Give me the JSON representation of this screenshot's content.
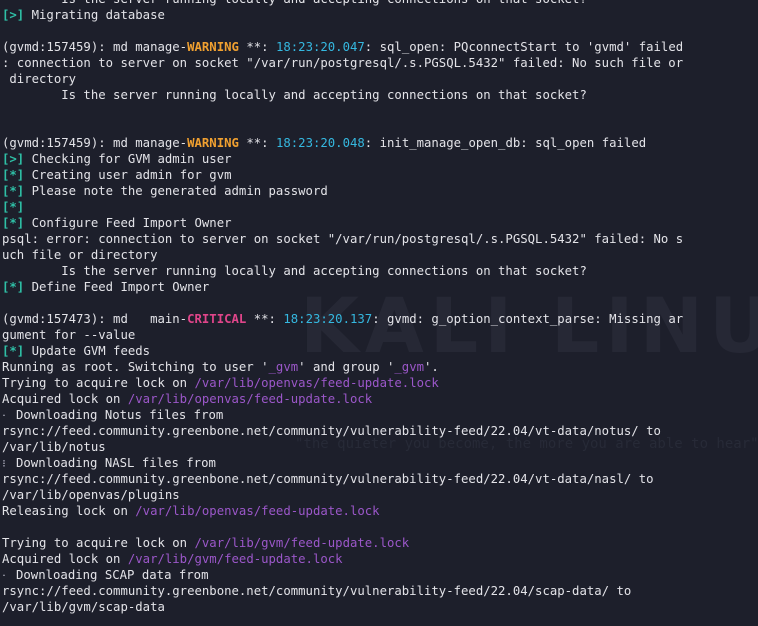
{
  "watermark": {
    "big": "KALI LINUX",
    "small": "\"the quieter you become, the more you are able to hear\""
  },
  "lines": [
    [
      {
        "t": "        Is the server running locally and accepting connections on that socket?"
      }
    ],
    [
      {
        "t": "[>]",
        "c": "tag"
      },
      {
        "t": " Migrating database"
      }
    ],
    [
      {
        "t": ""
      }
    ],
    [
      {
        "t": "(gvmd:157459): md manage-"
      },
      {
        "t": "WARNING",
        "c": "warn"
      },
      {
        "t": " **: "
      },
      {
        "t": "18:23:20.047",
        "c": "ts"
      },
      {
        "t": ": sql_open: PQconnectStart to 'gvmd' failed"
      }
    ],
    [
      {
        "t": ": connection to server on socket \"/var/run/postgresql/.s.PGSQL.5432\" failed: No such file or"
      }
    ],
    [
      {
        "t": " directory"
      }
    ],
    [
      {
        "t": "        Is the server running locally and accepting connections on that socket?"
      }
    ],
    [
      {
        "t": ""
      }
    ],
    [
      {
        "t": ""
      }
    ],
    [
      {
        "t": "(gvmd:157459): md manage-"
      },
      {
        "t": "WARNING",
        "c": "warn"
      },
      {
        "t": " **: "
      },
      {
        "t": "18:23:20.048",
        "c": "ts"
      },
      {
        "t": ": init_manage_open_db: sql_open failed"
      }
    ],
    [
      {
        "t": "[>]",
        "c": "tag"
      },
      {
        "t": " Checking for GVM admin user"
      }
    ],
    [
      {
        "t": "[*]",
        "c": "tag"
      },
      {
        "t": " Creating user admin for gvm"
      }
    ],
    [
      {
        "t": "[*]",
        "c": "tag"
      },
      {
        "t": " Please note the generated admin password"
      }
    ],
    [
      {
        "t": "[*]",
        "c": "tag"
      }
    ],
    [
      {
        "t": "[*]",
        "c": "tag"
      },
      {
        "t": " Configure Feed Import Owner"
      }
    ],
    [
      {
        "t": "psql: error: connection to server on socket \"/var/run/postgresql/.s.PGSQL.5432\" failed: No s"
      }
    ],
    [
      {
        "t": "uch file or directory"
      }
    ],
    [
      {
        "t": "        Is the server running locally and accepting connections on that socket?"
      }
    ],
    [
      {
        "t": "[*]",
        "c": "tag"
      },
      {
        "t": " Define Feed Import Owner"
      }
    ],
    [
      {
        "t": ""
      }
    ],
    [
      {
        "t": "(gvmd:157473): md   main-"
      },
      {
        "t": "CRITICAL",
        "c": "crit"
      },
      {
        "t": " **: "
      },
      {
        "t": "18:23:20.137",
        "c": "ts"
      },
      {
        "t": ": gvmd: g_option_context_parse: Missing ar"
      }
    ],
    [
      {
        "t": "gument for --value"
      }
    ],
    [
      {
        "t": "[*]",
        "c": "tag"
      },
      {
        "t": " Update GVM feeds"
      }
    ],
    [
      {
        "t": "Running as root. Switching to user '"
      },
      {
        "t": "_gvm",
        "c": "path"
      },
      {
        "t": "' and group '"
      },
      {
        "t": "_gvm",
        "c": "path"
      },
      {
        "t": "'."
      }
    ],
    [
      {
        "t": "Trying to acquire lock on "
      },
      {
        "t": "/var/lib/openvas/feed-update.lock",
        "c": "path"
      }
    ],
    [
      {
        "t": "Acquired lock on "
      },
      {
        "t": "/var/lib/openvas/feed-update.lock",
        "c": "path"
      }
    ],
    [
      {
        "t": "⠂",
        "c": "spin"
      },
      {
        "t": " Downloading Notus files from"
      }
    ],
    [
      {
        "t": "rsync://feed.community.greenbone.net/community/vulnerability-feed/22.04/vt-data/notus/ to"
      }
    ],
    [
      {
        "t": "/var/lib/notus"
      }
    ],
    [
      {
        "t": "⠇",
        "c": "spin"
      },
      {
        "t": " Downloading NASL files from"
      }
    ],
    [
      {
        "t": "rsync://feed.community.greenbone.net/community/vulnerability-feed/22.04/vt-data/nasl/ to"
      }
    ],
    [
      {
        "t": "/var/lib/openvas/plugins"
      }
    ],
    [
      {
        "t": "Releasing lock on "
      },
      {
        "t": "/var/lib/openvas/feed-update.lock",
        "c": "path"
      }
    ],
    [
      {
        "t": ""
      }
    ],
    [
      {
        "t": "Trying to acquire lock on "
      },
      {
        "t": "/var/lib/gvm/feed-update.lock",
        "c": "path"
      }
    ],
    [
      {
        "t": "Acquired lock on "
      },
      {
        "t": "/var/lib/gvm/feed-update.lock",
        "c": "path"
      }
    ],
    [
      {
        "t": "⠂",
        "c": "spin"
      },
      {
        "t": " Downloading SCAP data from"
      }
    ],
    [
      {
        "t": "rsync://feed.community.greenbone.net/community/vulnerability-feed/22.04/scap-data/ to"
      }
    ],
    [
      {
        "t": "/var/lib/gvm/scap-data"
      }
    ]
  ]
}
